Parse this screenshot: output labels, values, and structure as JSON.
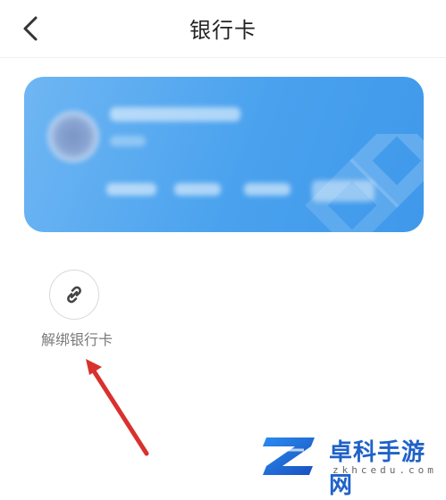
{
  "header": {
    "title": "银行卡",
    "back_icon": "chevron-left-icon"
  },
  "card": {
    "gradient_start": "#6fb6f3",
    "gradient_end": "#3f98ea",
    "content_blurred": true
  },
  "actions": {
    "unbind_label": "解绑银行卡",
    "unbind_icon": "link-icon"
  },
  "annotation": {
    "arrow_color": "#d9312d"
  },
  "watermark": {
    "name": "卓科手游网",
    "domain": "zkhcedu.com",
    "brand_color": "#1f62c8"
  }
}
